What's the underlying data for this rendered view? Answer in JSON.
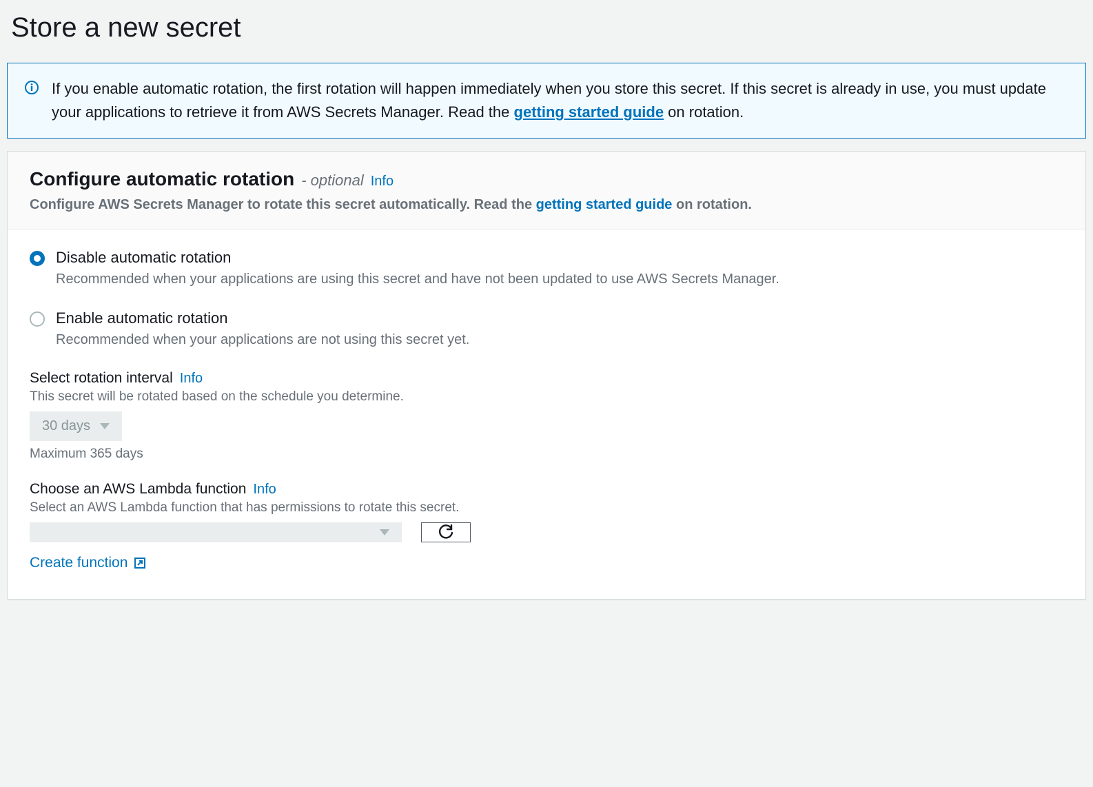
{
  "page_title": "Store a new secret",
  "alert": {
    "text_before_link": "If you enable automatic rotation, the first rotation will happen immediately when you store this secret. If this secret is already in use, you must update your applications to retrieve it from AWS Secrets Manager. Read the ",
    "link_text": "getting started guide",
    "text_after_link": " on rotation."
  },
  "panel": {
    "title": "Configure automatic rotation",
    "optional": "- optional",
    "info": "Info",
    "subtitle_before": "Configure AWS Secrets Manager to rotate this secret automatically. Read the ",
    "subtitle_link": "getting started guide",
    "subtitle_after": " on rotation."
  },
  "rotation_options": {
    "disable": {
      "label": "Disable automatic rotation",
      "desc": "Recommended when your applications are using this secret and have not been updated to use AWS Secrets Manager."
    },
    "enable": {
      "label": "Enable automatic rotation",
      "desc": "Recommended when your applications are not using this secret yet."
    }
  },
  "interval": {
    "label": "Select rotation interval",
    "info": "Info",
    "desc": "This secret will be rotated based on the schedule you determine.",
    "value": "30 days",
    "hint": "Maximum 365 days"
  },
  "lambda": {
    "label": "Choose an AWS Lambda function",
    "info": "Info",
    "desc": "Select an AWS Lambda function that has permissions to rotate this secret.",
    "value": "",
    "create_text": "Create function"
  }
}
